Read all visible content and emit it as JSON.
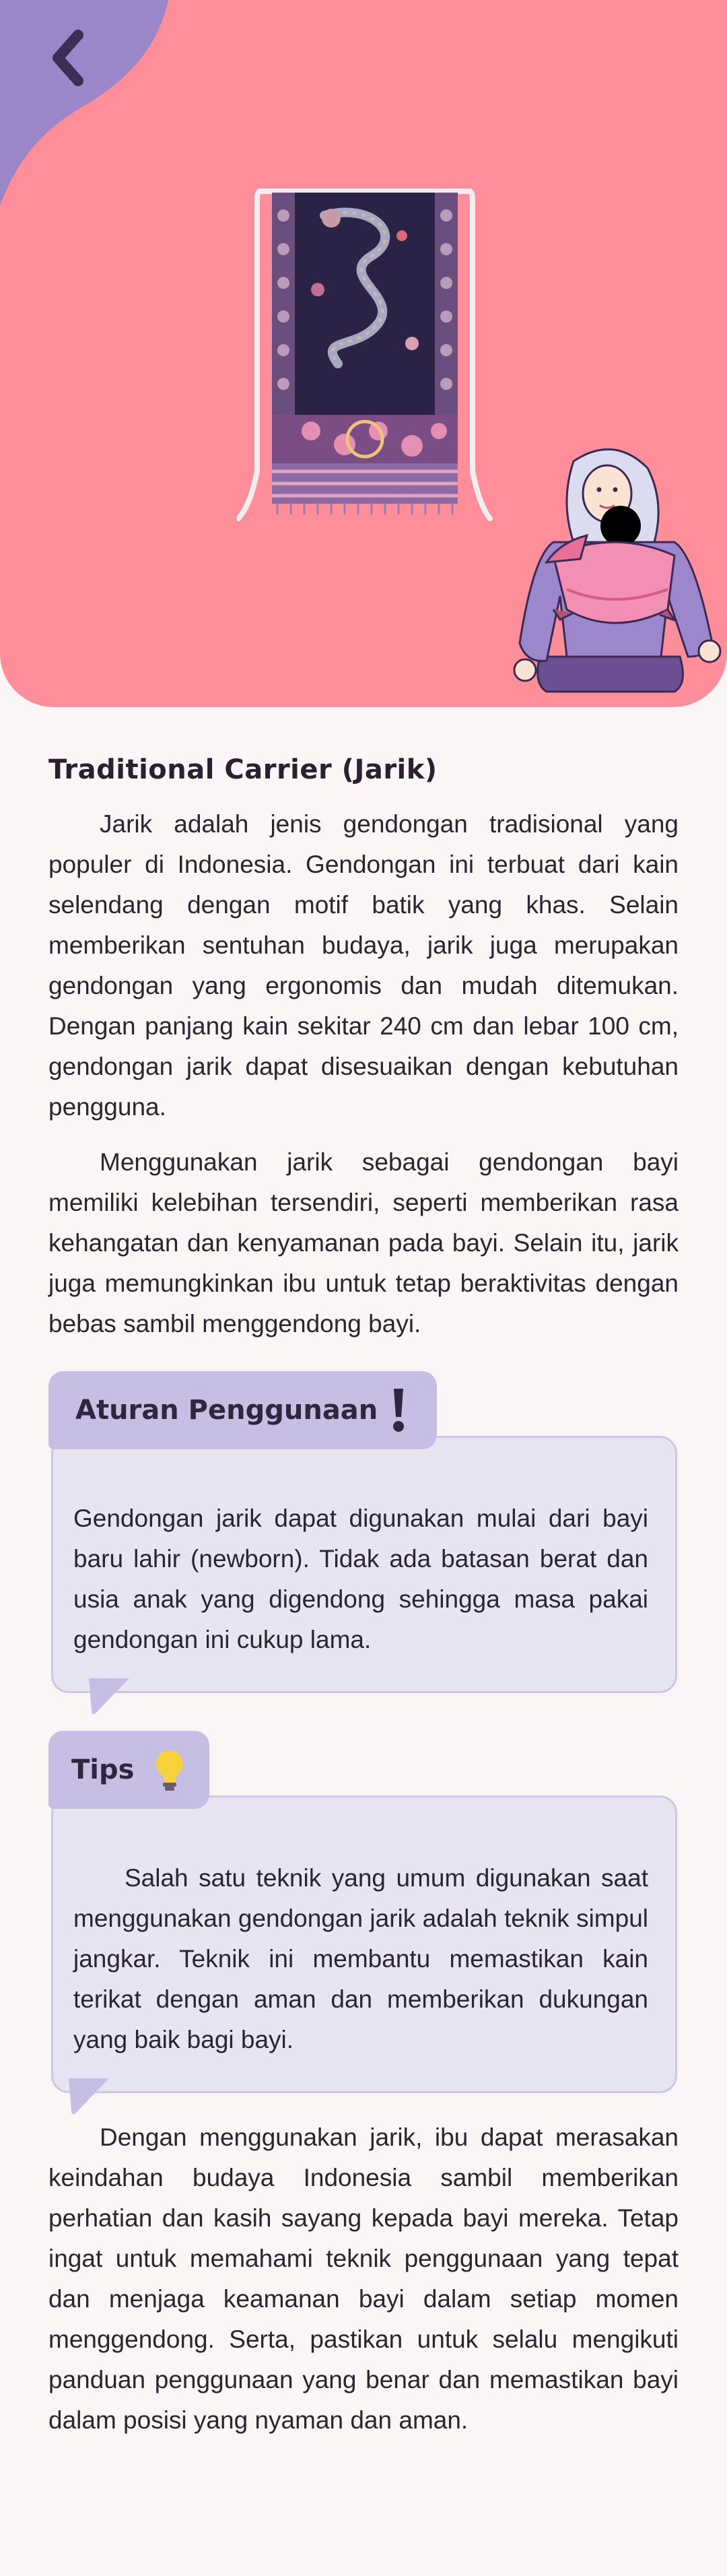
{
  "colors": {
    "hero_background": "#fe8e99",
    "back_blob": "#9a86c8",
    "accent_tab": "#c6bfe3",
    "note_background": "#e8e5f3",
    "page_background": "#fcf5f6"
  },
  "icons": {
    "back": "chevron-left",
    "warning": "exclamation-mark",
    "tips": "lightbulb"
  },
  "article": {
    "title": "Traditional Carrier (Jarik)",
    "paragraphs": [
      "Jarik adalah jenis gendongan tradisional yang populer di Indonesia. Gendongan ini terbuat dari kain selendang dengan motif batik yang khas. Selain memberikan sentuhan budaya, jarik juga merupakan gendongan yang ergonomis dan mudah ditemukan. Dengan panjang kain sekitar 240 cm dan lebar 100 cm, gendongan jarik dapat disesuaikan dengan kebutuhan pengguna.",
      "Menggunakan jarik sebagai gendongan bayi memiliki kelebihan tersendiri, seperti memberikan rasa kehangatan dan kenyamanan pada bayi. Selain itu, jarik juga memungkinkan ibu untuk tetap beraktivitas dengan bebas sambil menggendong bayi."
    ],
    "rules": {
      "label": "Aturan Penggunaan",
      "text": "Gendongan jarik dapat digunakan mulai dari bayi baru lahir (newborn). Tidak ada batasan berat dan usia anak yang digendong sehingga masa pakai gendongan ini cukup lama."
    },
    "tips": {
      "label": "Tips",
      "text": "Salah satu teknik yang umum digunakan saat menggunakan gendongan jarik adalah teknik simpul jangkar. Teknik ini membantu memastikan kain terikat dengan aman dan memberikan dukungan yang baik bagi bayi."
    },
    "closing": "Dengan menggunakan jarik, ibu dapat merasakan keindahan budaya Indonesia sambil memberikan perhatian dan kasih sayang kepada bayi mereka. Tetap ingat untuk memahami teknik penggunaan yang tepat dan menjaga keamanan bayi dalam setiap momen menggendong. Serta, pastikan untuk selalu mengikuti panduan penggunaan yang benar dan memastikan bayi dalam posisi yang nyaman dan aman."
  }
}
